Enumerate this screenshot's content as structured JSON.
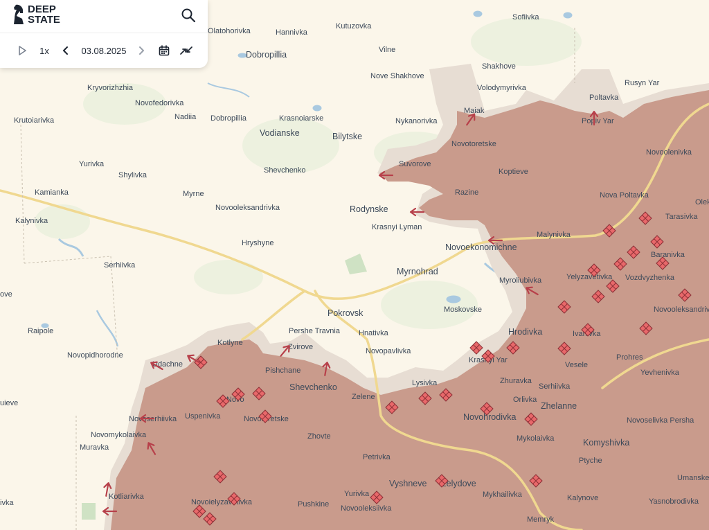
{
  "app": {
    "logo_line1": "DEEP",
    "logo_line2": "STATE",
    "date": "03.08.2025",
    "speed": "1x"
  },
  "icons": {
    "logo": "knight-logo-icon",
    "search": "search-icon",
    "play": "play-icon",
    "prev": "chevron-left-icon",
    "next": "chevron-right-icon",
    "calendar": "calendar-icon",
    "compare": "compare-arrows-icon"
  },
  "colors": {
    "background": "#fbf6ea",
    "occupied": "#c99b8c",
    "contested": "#e7ddd3",
    "road": "#f0d890",
    "water": "#a9c9e0",
    "attack_arrow": "#b7404a",
    "clash_marker": "#e8686a"
  },
  "places": [
    "Hannivka",
    "Kutuzovka",
    "Sofiivka",
    "Olatohorivka",
    "Dobropillia",
    "Vilne",
    "Shakhove",
    "Nove Shakhove",
    "Kryvorizhzhia",
    "Volodymyrivka",
    "Rusyn Yar",
    "Poltavka",
    "Novofedorivka",
    "Maiak",
    "Nadiia",
    "Dobropillia",
    "Krasnoiarske",
    "Nykanorivka",
    "Popiv Yar",
    "Krutoiarivka",
    "Vodianske",
    "Bilytske",
    "Novotoretske",
    "Novoolenivka",
    "Yurivka",
    "Suvorove",
    "Koptieve",
    "Shylivka",
    "Shevchenko",
    "Kamianka",
    "Myrne",
    "Razine",
    "Nova Poltavka",
    "Olek",
    "Novooleksandrivka",
    "Rodynske",
    "Tarasivka",
    "Kalynivka",
    "Krasnyi Lyman",
    "Malynivka",
    "Hryshyne",
    "Novoekonomichne",
    "Baranivka",
    "Serhiivka",
    "Yelyzavetivka",
    "Myrnohrad",
    "Vozdvyzhenka",
    "Myroliubivka",
    "ove",
    "Novooleksandrivka",
    "Pokrovsk",
    "Moskovske",
    "Pershe Travnia",
    "Hrodivka",
    "Raipole",
    "Hnativka",
    "Ivanivka",
    "Kotlyne",
    "Zvirove",
    "Novopavlivka",
    "Prohres",
    "Novopidhorodne",
    "Udachne",
    "Krasnyi Yar",
    "Vesele",
    "Pishchane",
    "Yevhenivka",
    "Lysivka",
    "Zhuravka",
    "Shevchenko",
    "Serhiivka",
    "Zelene",
    "Orlivka",
    "Novo",
    "Uspenivka",
    "Zhelanne",
    "uieve",
    "Novoserhiivka",
    "Novotoretske",
    "Novohrodivka",
    "Novoselivka Persha",
    "Novomykolaivka",
    "Zhovte",
    "Mykolaivka",
    "Komyshivka",
    "Muravka",
    "Petrivka",
    "Ptyche",
    "Umanske",
    "Vyshneve",
    "Zelydove",
    "Kotliarivka",
    "Yurivka",
    "Mykhailivka",
    "Kalynove",
    "Novoielyzavetivka",
    "Yasnobrodivka",
    "ivka",
    "Pushkine",
    "Novooleksiivka",
    "Memryk"
  ]
}
